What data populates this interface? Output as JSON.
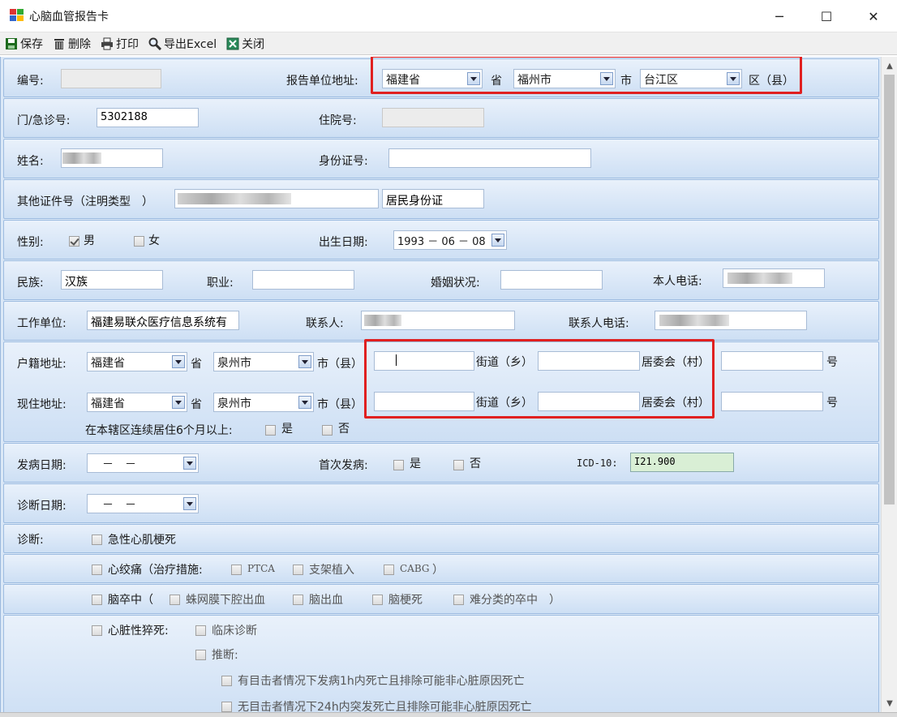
{
  "window": {
    "title": "心脑血管报告卡",
    "minimize": "─",
    "maximize": "☐",
    "close": "✕"
  },
  "toolbar": {
    "save": "保存",
    "delete": "删除",
    "print": "打印",
    "export": "导出Excel",
    "close": "关闭"
  },
  "form": {
    "serial_label": "编号:",
    "report_addr_label": "报告单位地址:",
    "report_province": "福建省",
    "province_suffix": "省",
    "report_city": "福州市",
    "city_suffix": "市",
    "report_district": "台江区",
    "district_suffix": "区（县）",
    "outpatient_label": "门/急诊号:",
    "outpatient_value": "5302188",
    "inpatient_label": "住院号:",
    "name_label": "姓名:",
    "idcard_label": "身份证号:",
    "other_id_label": "其他证件号（注明类型　）",
    "other_id_type": "居民身份证",
    "gender_label": "性别:",
    "male": "男",
    "female": "女",
    "birth_label": "出生日期:",
    "birth_value": "1993 － 06 － 08",
    "ethnic_label": "民族:",
    "ethnic_value": "汉族",
    "job_label": "职业:",
    "marital_label": "婚姻状况:",
    "phone_label": "本人电话:",
    "work_label": "工作单位:",
    "work_value": "福建易联众医疗信息系统有",
    "contact_label": "联系人:",
    "contact_phone_label": "联系人电话:",
    "hukou_label": "户籍地址:",
    "hukou_province": "福建省",
    "hukou_city": "泉州市",
    "city_county_suffix": "市（县）",
    "street_suffix": "街道（乡）",
    "committee_suffix": "居委会（村）",
    "number_suffix": "号",
    "current_label": "现住地址:",
    "current_province": "福建省",
    "current_city": "泉州市",
    "resident_label": "在本辖区连续居住6个月以上:",
    "yes": "是",
    "no": "否",
    "onset_label": "发病日期:",
    "onset_value": "－　－",
    "first_onset_label": "首次发病:",
    "icd_label": "ICD-10:",
    "icd_value": "I21.900",
    "diag_date_label": "诊断日期:",
    "diag_date_value": "－　－",
    "diag_label": "诊断:",
    "ami": "急性心肌梗死",
    "angina": "心绞痛（治疗措施:",
    "ptca": "PTCA",
    "stent": "支架植入",
    "cabg": "CABG",
    "cabg_close": "）",
    "stroke": "脑卒中（",
    "sah": "蛛网膜下腔出血",
    "ich": "脑出血",
    "infarct": "脑梗死",
    "unclassified": "难分类的卒中",
    "stroke_close": "）",
    "scd": "心脏性猝死:",
    "clinical": "临床诊断",
    "inferred": "推断:",
    "scd_opt1": "有目击者情况下发病1h内死亡且排除可能非心脏原因死亡",
    "scd_opt2": "无目击者情况下24h内突发死亡且排除可能非心脏原因死亡"
  },
  "colors": {
    "highlight": "#e02020",
    "panel": "#dbe8f7",
    "icd_bg": "#d9efd5"
  }
}
